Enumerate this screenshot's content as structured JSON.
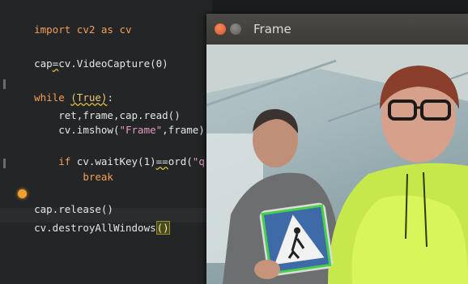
{
  "editor": {
    "lines": {
      "l1_kw": "import",
      "l1_mod": " cv2 ",
      "l1_as": "as",
      "l1_alias": " cv",
      "l2_a": "cap",
      "l2_b": "=",
      "l2_c": "cv.VideoCapture(0)",
      "l3_kw": "while",
      "l3_sp": " ",
      "l3_cond": "(True)",
      "l3_end": ":",
      "l4": "    ret,frame,cap.read()",
      "l5_a": "    cv.imshow(",
      "l5_str": "\"Frame\"",
      "l5_b": ",frame)",
      "l6_kw": "    if",
      "l6_a": " cv.waitKey(1)",
      "l6_op": "==",
      "l6_b": "ord(",
      "l6_str": "\"q\"",
      "l6_c": "):",
      "l7": "        break",
      "l8": "cap.release()",
      "l9_a": "cv.destroyAllWindows",
      "l9_b": "()"
    }
  },
  "window": {
    "title": "Frame"
  },
  "colors": {
    "editor_bg": "#232526",
    "keyword": "#f5a05a",
    "string": "#e59cc4",
    "close_button": "#d9532a"
  }
}
